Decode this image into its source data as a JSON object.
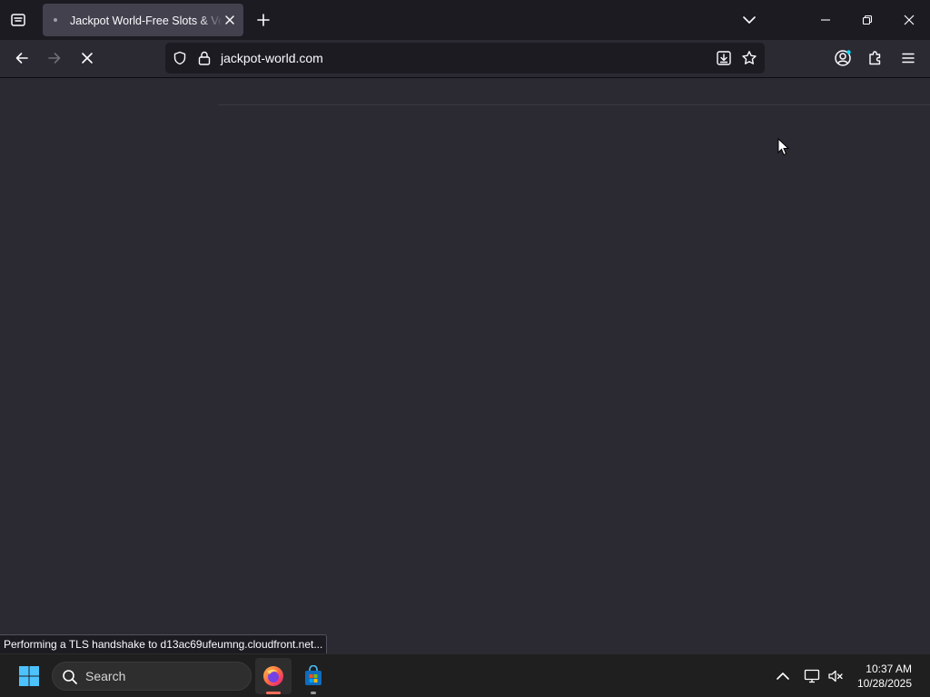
{
  "browser": {
    "tab": {
      "title": "Jackpot World-Free Slots & Vegas Casino"
    },
    "url": "jackpot-world.com",
    "status_text": "Performing a TLS handshake to d13ac69ufeumng.cloudfront.net..."
  },
  "taskbar": {
    "search_label": "Search",
    "time": "10:37 AM",
    "date": "10/28/2025"
  },
  "icons": {
    "tab_overview": "tab-overview-icon",
    "tab_close": "close-icon",
    "new_tab": "plus-icon",
    "tab_list": "chevron-down-icon",
    "minimize": "minimize-icon",
    "restore": "restore-icon",
    "close_window": "close-icon",
    "back": "back-arrow-icon",
    "forward": "forward-arrow-icon",
    "stop": "stop-icon",
    "shield": "shield-icon",
    "lock": "lock-icon",
    "install_app": "install-icon",
    "bookmark": "star-icon",
    "account": "account-icon",
    "extensions": "puzzle-icon",
    "menu": "hamburger-menu-icon",
    "start": "windows-logo-icon",
    "search": "search-icon",
    "firefox": "firefox-icon",
    "store": "store-icon",
    "tray_overflow": "chevron-up-icon",
    "network": "network-icon",
    "volume": "volume-muted-icon"
  },
  "colors": {
    "accent": "#00ddff",
    "firefox_running_indicator": "#ff6f5b",
    "windows_blue": "#4cc2ff"
  }
}
